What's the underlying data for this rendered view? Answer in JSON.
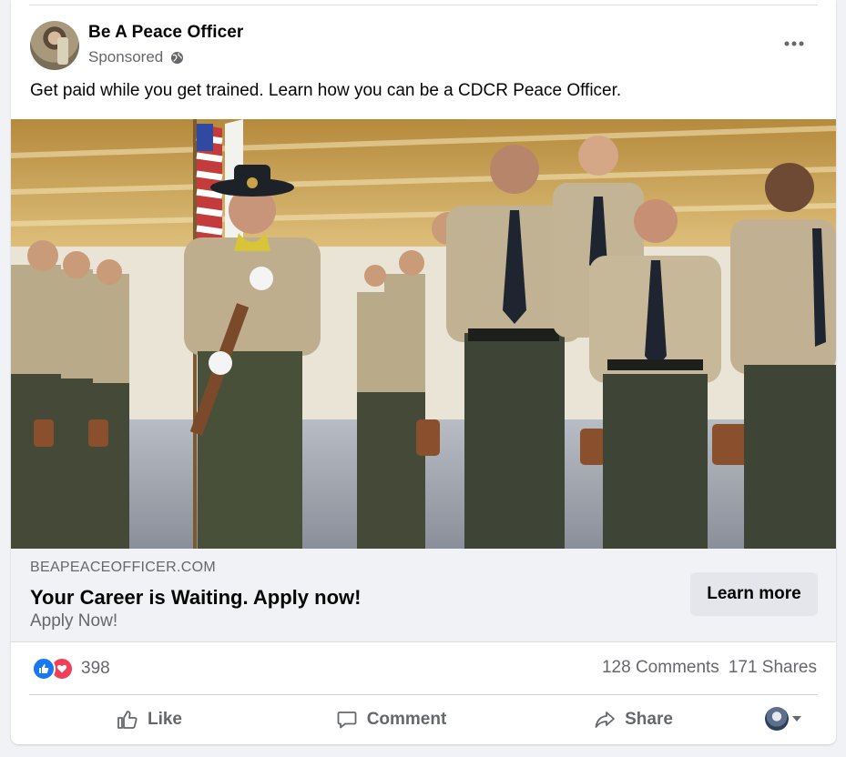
{
  "post": {
    "page_name": "Be A Peace Officer",
    "sponsored_label": "Sponsored",
    "text": "Get paid while you get trained. Learn how you can be a CDCR Peace Officer."
  },
  "link": {
    "domain": "BEAPEACEOFFICER.COM",
    "title": "Your Career is Waiting. Apply now!",
    "description": "Apply Now!",
    "cta_label": "Learn more"
  },
  "stats": {
    "reaction_count": "398",
    "comments": "128 Comments",
    "shares": "171 Shares"
  },
  "actions": {
    "like": "Like",
    "comment": "Comment",
    "share": "Share"
  },
  "colors": {
    "like_blue": "#1877f2",
    "love_red": "#f33e58",
    "secondary_text": "#65676b"
  },
  "icons": [
    "globe-icon",
    "more-icon",
    "like-reaction-icon",
    "love-reaction-icon",
    "thumbs-up-icon",
    "comment-icon",
    "share-icon",
    "chevron-down-icon"
  ]
}
